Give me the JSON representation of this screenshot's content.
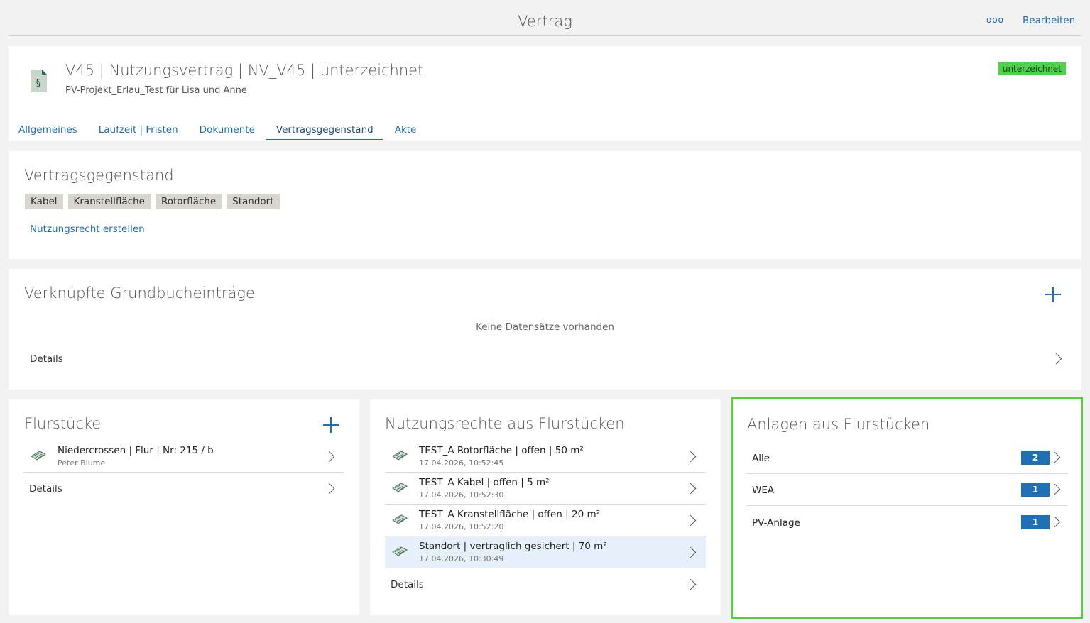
{
  "topbar": {
    "title": "Vertrag",
    "more_label": "ooo",
    "edit_label": "Bearbeiten"
  },
  "header": {
    "title": "V45 | Nutzungsvertrag | NV_V45 | unterzeichnet",
    "subtitle": "PV-Projekt_Erlau_Test für Lisa und Anne",
    "status_badge": "unterzeichnet",
    "status_color": "#4cd34c",
    "icon": "contract-paragraph-icon",
    "tabs": [
      {
        "label": "Allgemeines"
      },
      {
        "label": "Laufzeit | Fristen"
      },
      {
        "label": "Dokumente"
      },
      {
        "label": "Vertragsgegenstand",
        "active": true
      },
      {
        "label": "Akte"
      }
    ]
  },
  "vertragsgegenstand": {
    "title": "Vertragsgegenstand",
    "tags": [
      "Kabel",
      "Kranstellfläche",
      "Rotorfläche",
      "Standort"
    ],
    "create_link": "Nutzungsrecht erstellen"
  },
  "grundbuch": {
    "title": "Verknüpfte Grundbucheinträge",
    "empty_text": "Keine Datensätze vorhanden",
    "details_label": "Details"
  },
  "flurstuecke": {
    "title": "Flurstücke",
    "items": [
      {
        "title": "Niedercrossen | Flur | Nr: 215 / b",
        "subtitle": "Peter Blume"
      }
    ],
    "details_label": "Details"
  },
  "nutzungsrechte": {
    "title": "Nutzungsrechte aus Flurstücken",
    "items": [
      {
        "title": "TEST_A Rotorfläche | offen | 50 m²",
        "subtitle": "17.04.2026, 10:52:45"
      },
      {
        "title": "TEST_A Kabel | offen | 5 m²",
        "subtitle": "17.04.2026, 10:52:30"
      },
      {
        "title": "TEST_A Kranstellfläche | offen | 20 m²",
        "subtitle": "17.04.2026, 10:52:20"
      },
      {
        "title": "Standort | vertraglich gesichert | 70 m²",
        "subtitle": "17.04.2026, 10:30:49",
        "highlighted": true
      }
    ],
    "details_label": "Details"
  },
  "anlagen": {
    "title": "Anlagen aus Flurstücken",
    "items": [
      {
        "label": "Alle",
        "count": "2"
      },
      {
        "label": "WEA",
        "count": "1"
      },
      {
        "label": "PV-Anlage",
        "count": "1"
      }
    ]
  },
  "colors": {
    "accent": "#1f6fb5",
    "highlight_border": "#44dd22"
  }
}
